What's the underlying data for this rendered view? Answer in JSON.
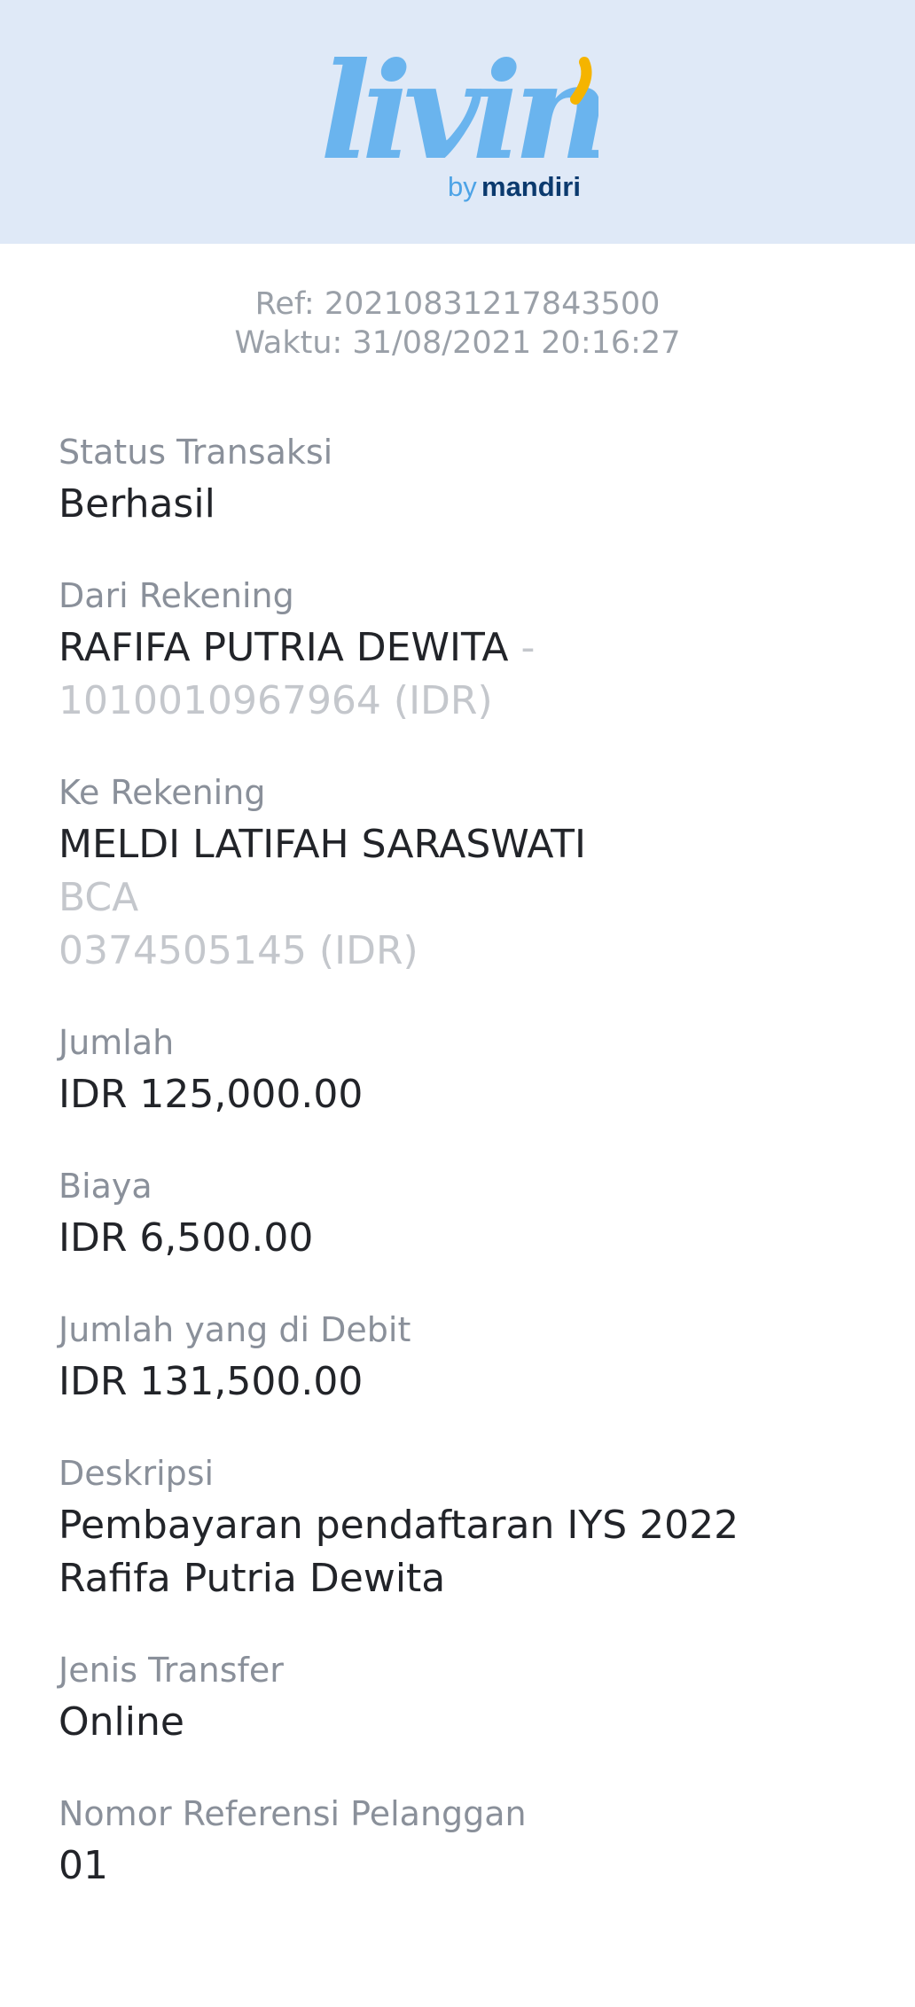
{
  "header": {
    "brand_word": "livin'",
    "brand_by": "by",
    "brand_name": "mandiri",
    "colors": {
      "background": "#dfe9f7",
      "logo_blue": "#6ab4ee",
      "logo_accent": "#f5b400",
      "mandiri_navy": "#0b3a6e",
      "by_blue": "#4da3e6"
    }
  },
  "meta": {
    "ref": "Ref: 20210831217843500",
    "time": "Waktu: 31/08/2021 20:16:27"
  },
  "details": {
    "status": {
      "label": "Status Transaksi",
      "value": "Berhasil"
    },
    "from": {
      "label": "Dari Rekening",
      "name": "RAFIFA PUTRIA DEWITA",
      "account": " - 1010010967964 (IDR)"
    },
    "to": {
      "label": "Ke Rekening",
      "name": "MELDI LATIFAH SARASWATI",
      "bank": "BCA",
      "account": "0374505145 (IDR)"
    },
    "amount": {
      "label": "Jumlah",
      "value": "IDR 125,000.00"
    },
    "fee": {
      "label": "Biaya",
      "value": "IDR 6,500.00"
    },
    "debited": {
      "label": "Jumlah yang di Debit",
      "value": "IDR 131,500.00"
    },
    "description": {
      "label": "Deskripsi",
      "value": "Pembayaran pendaftaran IYS 2022 Rafifa Putria Dewita"
    },
    "transfer_type": {
      "label": "Jenis Transfer",
      "value": "Online"
    },
    "customer_ref": {
      "label": "Nomor Referensi Pelanggan",
      "value": "01"
    }
  }
}
